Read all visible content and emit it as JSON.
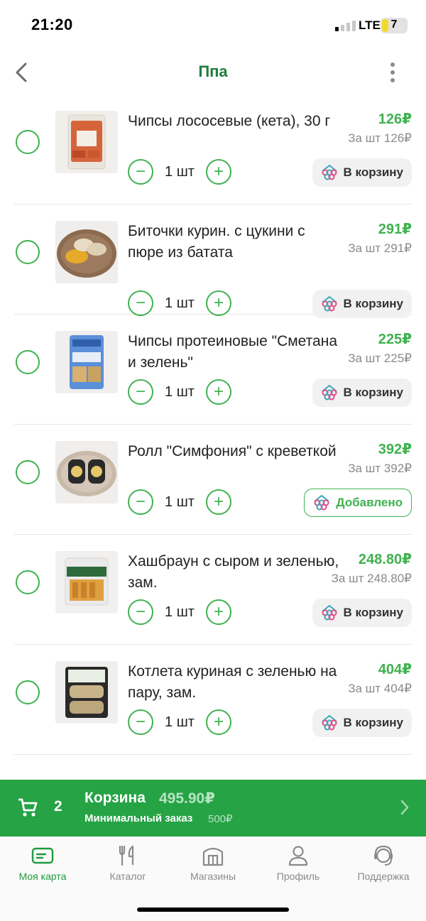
{
  "status_bar": {
    "time": "21:20",
    "network": "LTE",
    "battery": "7"
  },
  "header": {
    "title": "Ппа"
  },
  "items": [
    {
      "name": "Чипсы лососевые (кета), 30 г",
      "price": "126₽",
      "unit_price": "За шт 126₽",
      "qty": "1 шт",
      "cart_label": "В корзину",
      "added": false
    },
    {
      "name": "Биточки курин. с цукини с пюре из батата",
      "price": "291₽",
      "unit_price": "За шт 291₽",
      "qty": "1 шт",
      "cart_label": "В корзину",
      "added": false
    },
    {
      "name": "Чипсы протеиновые \"Сметана и зелень\"",
      "price": "225₽",
      "unit_price": "За шт 225₽",
      "qty": "1 шт",
      "cart_label": "В корзину",
      "added": false
    },
    {
      "name": "Ролл \"Симфония\" с креветкой",
      "price": "392₽",
      "unit_price": "За шт 392₽",
      "qty": "1 шт",
      "cart_label": "Добавлено",
      "added": true
    },
    {
      "name": "Хашбраун с сыром и зеленью, зам.",
      "price": "248.80₽",
      "unit_price": "За шт 248.80₽",
      "qty": "1 шт",
      "cart_label": "В корзину",
      "added": false
    },
    {
      "name": "Котлета куриная с зеленью на пару, зам.",
      "price": "404₽",
      "unit_price": "За шт 404₽",
      "qty": "1 шт",
      "cart_label": "В корзину",
      "added": false
    }
  ],
  "cart_bar": {
    "count": "2",
    "label": "Корзина",
    "total": "495.90₽",
    "min_label": "Минимальный заказ",
    "min_value": "500₽"
  },
  "tabs": [
    {
      "label": "Моя карта",
      "icon": "card-icon",
      "active": true
    },
    {
      "label": "Каталог",
      "icon": "fork-knife-icon",
      "active": false
    },
    {
      "label": "Магазины",
      "icon": "store-icon",
      "active": false
    },
    {
      "label": "Профиль",
      "icon": "person-icon",
      "active": false
    },
    {
      "label": "Поддержка",
      "icon": "headset-icon",
      "active": false
    }
  ],
  "colors": {
    "accent": "#3fb24f",
    "cart_bar": "#25a345",
    "title": "#1e7d3c"
  }
}
